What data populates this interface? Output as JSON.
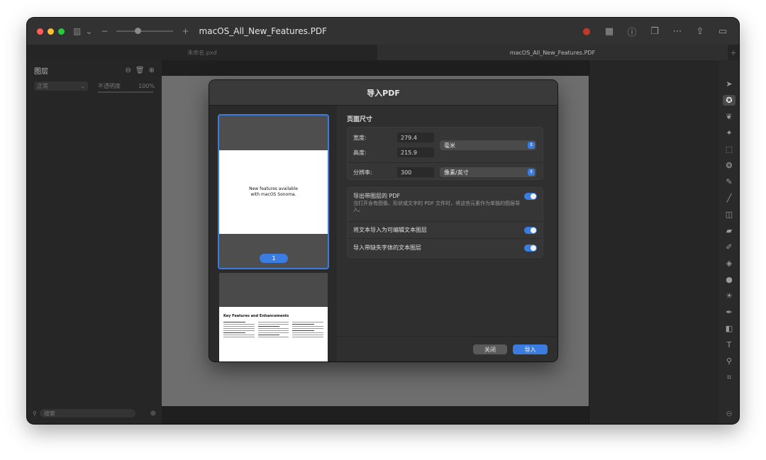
{
  "window": {
    "title": "macOS_All_New_Features.PDF",
    "traffic_lights": {
      "close": "#ff5f57",
      "minimize": "#febc2e",
      "zoom": "#28c840"
    }
  },
  "tabs": [
    {
      "label": "未命名.pxd"
    },
    {
      "label": "macOS_All_New_Features.PDF"
    }
  ],
  "icons": {
    "sidebar_toggle": "▥",
    "chevron": "⌄",
    "zoom_out": "−",
    "zoom_in": "+",
    "share": "⇪",
    "info": "ⓘ",
    "more": "⋯",
    "panel": "▭",
    "tab_add": "+",
    "search": "⚲",
    "add_circle": "⊕"
  },
  "colors": {
    "accent": "#3a7ce0"
  },
  "layers_panel": {
    "title": "图层",
    "blend_mode": "正常",
    "opacity_label": "不透明度",
    "opacity_value": "100%",
    "search_placeholder": "搜索"
  },
  "dialog": {
    "title": "导入PDF",
    "page_size_title": "页面尺寸",
    "width_label": "宽度:",
    "width_value": "279.4",
    "height_label": "高度:",
    "height_value": "215.9",
    "unit_select": "毫米",
    "resolution_label": "分辨率:",
    "resolution_value": "300",
    "resolution_unit_select": "像素/英寸",
    "options": [
      {
        "title": "导出带图层的 PDF",
        "description": "当打开含有图像、形状或文字的 PDF 文件时，将这些元素作为单独的图层导入。",
        "enabled": true
      },
      {
        "title": "将文本导入为可编辑文本图层",
        "enabled": true
      },
      {
        "title": "导入带缺失字体的文本图层",
        "enabled": true
      }
    ],
    "close_button": "关闭",
    "import_button": "导入"
  },
  "thumbnails": [
    {
      "page_text": "New features available with macOS Sonoma.",
      "page_number": "1"
    },
    {
      "heading": "Key Features and Enhancements"
    }
  ]
}
